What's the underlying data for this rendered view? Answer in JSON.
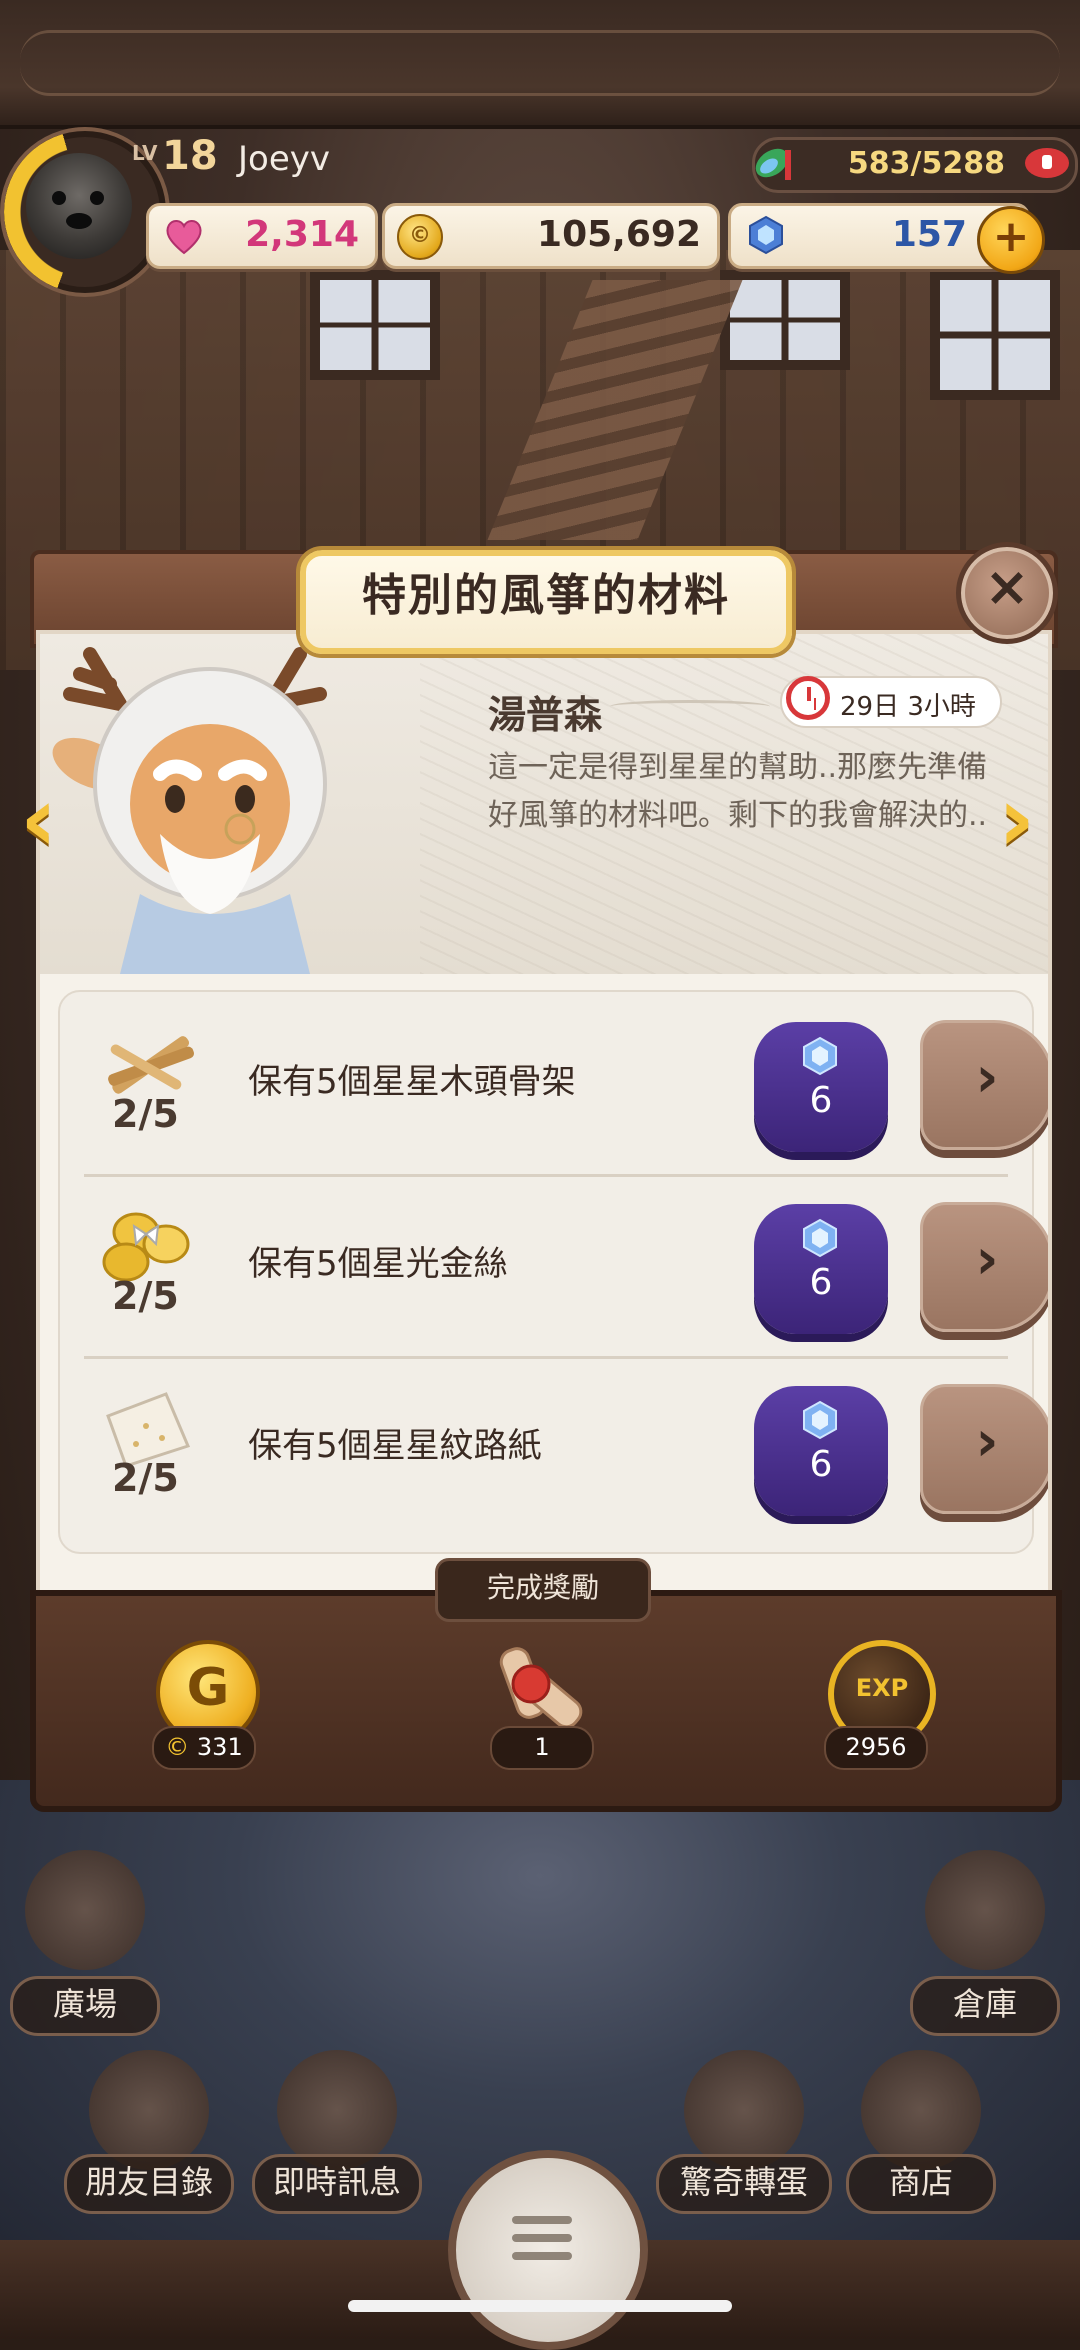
{
  "player": {
    "level_prefix": "LV",
    "level": "18",
    "name": "Joeyv"
  },
  "resources": {
    "energy": "583/5288",
    "hearts": "2,314",
    "gold": "105,692",
    "gems": "157",
    "gold_symbol": "©",
    "plus": "+"
  },
  "dialog": {
    "title": "特別的風箏的材料",
    "close": "×",
    "npc_name": "湯普森",
    "timer": "29日 3小時",
    "dialogue": "這一定是得到星星的幫助..那麼先準備好風箏的材料吧。剩下的我會解決的..",
    "prev_arrow": "‹",
    "next_arrow": "›",
    "tasks": [
      {
        "label": "保有5個星星木頭骨架",
        "progress": "2/5",
        "gem_cost": "6",
        "go": "›",
        "icon": "wood-sticks-icon"
      },
      {
        "label": "保有5個星光金絲",
        "progress": "2/5",
        "gem_cost": "6",
        "go": "›",
        "icon": "gold-thread-icon"
      },
      {
        "label": "保有5個星星紋路紙",
        "progress": "2/5",
        "gem_cost": "6",
        "go": "›",
        "icon": "paper-icon"
      }
    ],
    "reward_title": "完成獎勵",
    "rewards": {
      "gold": {
        "amount": "331",
        "coin_letter": "G",
        "badge_symbol": "©"
      },
      "scroll": {
        "amount": "1"
      },
      "exp": {
        "amount": "2956",
        "label": "EXP"
      }
    }
  },
  "nav": {
    "plaza": "廣場",
    "warehouse": "倉庫",
    "friends": "朋友目錄",
    "messages": "即時訊息",
    "gacha": "驚奇轉蛋",
    "shop": "商店"
  },
  "colors": {
    "heart": "#d2377a",
    "gem": "#2c56a6",
    "gem_button": "#4a2f8f",
    "accent_gold": "#f2c230"
  }
}
